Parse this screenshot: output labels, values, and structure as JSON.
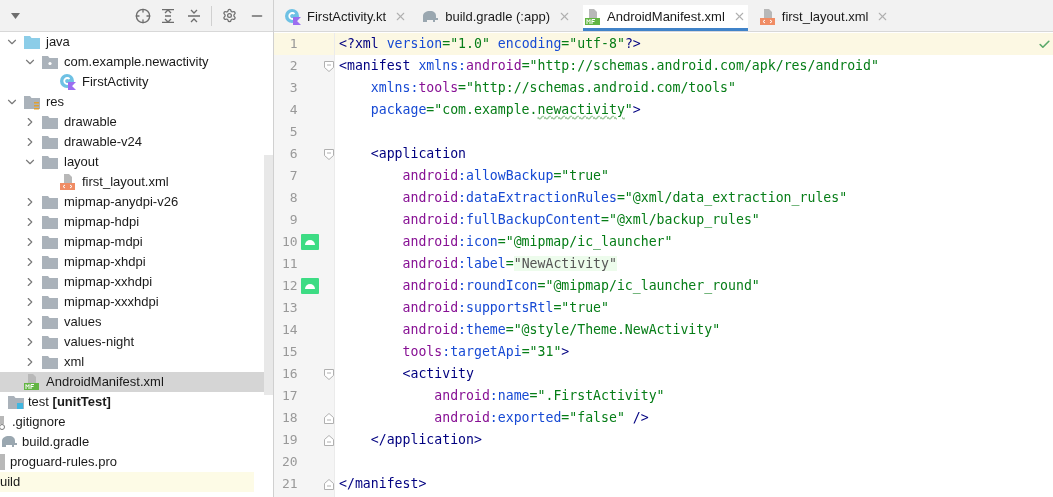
{
  "tree": [
    {
      "label": "java",
      "kind": "source-folder",
      "expanded": true,
      "selected": false,
      "children": [
        {
          "label": "com.example.newactivity",
          "kind": "package",
          "expanded": true,
          "selected": false,
          "children": [
            {
              "label": "FirstActivity",
              "kind": "kotlin-class",
              "selected": false
            }
          ]
        }
      ]
    },
    {
      "label": "res",
      "kind": "res-folder",
      "expanded": true,
      "selected": false,
      "children": [
        {
          "label": "drawable",
          "kind": "folder",
          "expanded": false,
          "selected": false
        },
        {
          "label": "drawable-v24",
          "kind": "folder",
          "expanded": false,
          "selected": false
        },
        {
          "label": "layout",
          "kind": "folder",
          "expanded": true,
          "selected": false,
          "children": [
            {
              "label": "first_layout.xml",
              "kind": "layout-file",
              "selected": false
            }
          ]
        },
        {
          "label": "mipmap-anydpi-v26",
          "kind": "folder",
          "expanded": false,
          "selected": false
        },
        {
          "label": "mipmap-hdpi",
          "kind": "folder",
          "expanded": false,
          "selected": false
        },
        {
          "label": "mipmap-mdpi",
          "kind": "folder",
          "expanded": false,
          "selected": false
        },
        {
          "label": "mipmap-xhdpi",
          "kind": "folder",
          "expanded": false,
          "selected": false
        },
        {
          "label": "mipmap-xxhdpi",
          "kind": "folder",
          "expanded": false,
          "selected": false
        },
        {
          "label": "mipmap-xxxhdpi",
          "kind": "folder",
          "expanded": false,
          "selected": false
        },
        {
          "label": "values",
          "kind": "folder",
          "expanded": false,
          "selected": false
        },
        {
          "label": "values-night",
          "kind": "folder",
          "expanded": false,
          "selected": false
        },
        {
          "label": "xml",
          "kind": "folder",
          "expanded": false,
          "selected": false
        }
      ]
    },
    {
      "label": "AndroidManifest.xml",
      "kind": "manifest-file",
      "selected": true
    }
  ],
  "outer_items": [
    {
      "label": "test **[unitTest]**",
      "kind": "test-folder",
      "selected": false
    }
  ],
  "module_items": [
    {
      "label": ".gitignore",
      "kind": "ignore-file",
      "highlighted": false
    },
    {
      "label": "build.gradle",
      "kind": "gradle-file",
      "highlighted": false
    },
    {
      "label": "proguard-rules.pro",
      "kind": "text-file",
      "highlighted": false
    },
    {
      "label": "uild",
      "kind": "none",
      "highlighted": true
    }
  ],
  "tabs": [
    {
      "label": "FirstActivity.kt",
      "kind": "kotlin-class",
      "selected": false
    },
    {
      "label": "build.gradle (:app)",
      "kind": "gradle-file",
      "selected": false
    },
    {
      "label": "AndroidManifest.xml",
      "kind": "manifest-file",
      "selected": true
    },
    {
      "label": "first_layout.xml",
      "kind": "layout-file",
      "selected": false
    }
  ],
  "lines": [
    {
      "number": "1",
      "current": true,
      "tokens": [
        {
          "kind": "tag",
          "text": "<?xml"
        },
        {
          "kind": "attr",
          "text": " version"
        },
        {
          "kind": "str",
          "text": "=\"1.0\""
        },
        {
          "kind": "attr",
          "text": " encoding"
        },
        {
          "kind": "str",
          "text": "=\"utf-8\""
        },
        {
          "kind": "tag",
          "text": "?>"
        }
      ]
    },
    {
      "number": "2",
      "current": false,
      "fold_start": true,
      "tokens": [
        {
          "kind": "tag",
          "text": "<manifest"
        },
        {
          "kind": "attr",
          "text": " xmlns:"
        },
        {
          "kind": "ns",
          "text": "android"
        },
        {
          "kind": "str",
          "text": "=\"http://schemas.android.com/apk/res/android\""
        }
      ]
    },
    {
      "number": "3",
      "current": false,
      "tokens": [
        {
          "kind": "attr",
          "text": "    xmlns:"
        },
        {
          "kind": "ns",
          "text": "tools"
        },
        {
          "kind": "str",
          "text": "=\"http://schemas.android.com/tools\""
        }
      ]
    },
    {
      "number": "4",
      "current": false,
      "tokens": [
        {
          "kind": "attr",
          "text": "    package"
        },
        {
          "kind": "str",
          "text": "=\"com.example."
        },
        {
          "kind": "str-typo",
          "text": "newactivity"
        },
        {
          "kind": "str",
          "text": "\""
        },
        {
          "kind": "tag",
          "text": ">"
        }
      ]
    },
    {
      "number": "5",
      "current": false
    },
    {
      "number": "6",
      "current": false,
      "fold_start": true,
      "tokens": [
        {
          "kind": "tag",
          "text": "    <application"
        }
      ]
    },
    {
      "number": "7",
      "current": false,
      "tokens": [
        {
          "kind": "ns",
          "text": "        android"
        },
        {
          "kind": "attr",
          "text": ":allowBackup"
        },
        {
          "kind": "str",
          "text": "=\"true\""
        }
      ]
    },
    {
      "number": "8",
      "current": false,
      "tokens": [
        {
          "kind": "ns",
          "text": "        android"
        },
        {
          "kind": "attr",
          "text": ":dataExtractionRules"
        },
        {
          "kind": "str",
          "text": "=\"@xml/data_extraction_rules\""
        }
      ]
    },
    {
      "number": "9",
      "current": false,
      "tokens": [
        {
          "kind": "ns",
          "text": "        android"
        },
        {
          "kind": "attr",
          "text": ":fullBackupContent"
        },
        {
          "kind": "str",
          "text": "=\"@xml/backup_rules\""
        }
      ]
    },
    {
      "number": "10",
      "current": false,
      "android_icon": true,
      "tokens": [
        {
          "kind": "ns",
          "text": "        android"
        },
        {
          "kind": "attr",
          "text": ":icon"
        },
        {
          "kind": "str",
          "text": "=\"@mipmap/ic_launcher\""
        }
      ]
    },
    {
      "number": "11",
      "current": false,
      "tokens": [
        {
          "kind": "ns",
          "text": "        android"
        },
        {
          "kind": "attr",
          "text": ":label"
        },
        {
          "kind": "str",
          "text": "="
        },
        {
          "kind": "str-hint",
          "text": "\"NewActivity\""
        }
      ]
    },
    {
      "number": "12",
      "current": false,
      "android_icon": true,
      "tokens": [
        {
          "kind": "ns",
          "text": "        android"
        },
        {
          "kind": "attr",
          "text": ":roundIcon"
        },
        {
          "kind": "str",
          "text": "=\"@mipmap/ic_launcher_round\""
        }
      ]
    },
    {
      "number": "13",
      "current": false,
      "tokens": [
        {
          "kind": "ns",
          "text": "        android"
        },
        {
          "kind": "attr",
          "text": ":supportsRtl"
        },
        {
          "kind": "str",
          "text": "=\"true\""
        }
      ]
    },
    {
      "number": "14",
      "current": false,
      "tokens": [
        {
          "kind": "ns",
          "text": "        android"
        },
        {
          "kind": "attr",
          "text": ":theme"
        },
        {
          "kind": "str",
          "text": "=\"@style/Theme.NewActivity\""
        }
      ]
    },
    {
      "number": "15",
      "current": false,
      "tokens": [
        {
          "kind": "ns",
          "text": "        tools"
        },
        {
          "kind": "attr",
          "text": ":targetApi"
        },
        {
          "kind": "str",
          "text": "=\"31\""
        },
        {
          "kind": "tag",
          "text": ">"
        }
      ]
    },
    {
      "number": "16",
      "current": false,
      "fold_start": true,
      "tokens": [
        {
          "kind": "tag",
          "text": "        <activity"
        }
      ]
    },
    {
      "number": "17",
      "current": false,
      "tokens": [
        {
          "kind": "ns",
          "text": "            android"
        },
        {
          "kind": "attr",
          "text": ":name"
        },
        {
          "kind": "str",
          "text": "=\".FirstActivity\""
        }
      ]
    },
    {
      "number": "18",
      "current": false,
      "fold_end": true,
      "tokens": [
        {
          "kind": "ns",
          "text": "            android"
        },
        {
          "kind": "attr",
          "text": ":exported"
        },
        {
          "kind": "str",
          "text": "=\"false\""
        },
        {
          "kind": "tag",
          "text": " />"
        }
      ]
    },
    {
      "number": "19",
      "current": false,
      "fold_end": true,
      "tokens": [
        {
          "kind": "tag",
          "text": "    </application>"
        }
      ]
    },
    {
      "number": "20",
      "current": false
    },
    {
      "number": "21",
      "current": false,
      "fold_end": true,
      "tokens": [
        {
          "kind": "tag",
          "text": "</manifest>"
        }
      ]
    }
  ]
}
